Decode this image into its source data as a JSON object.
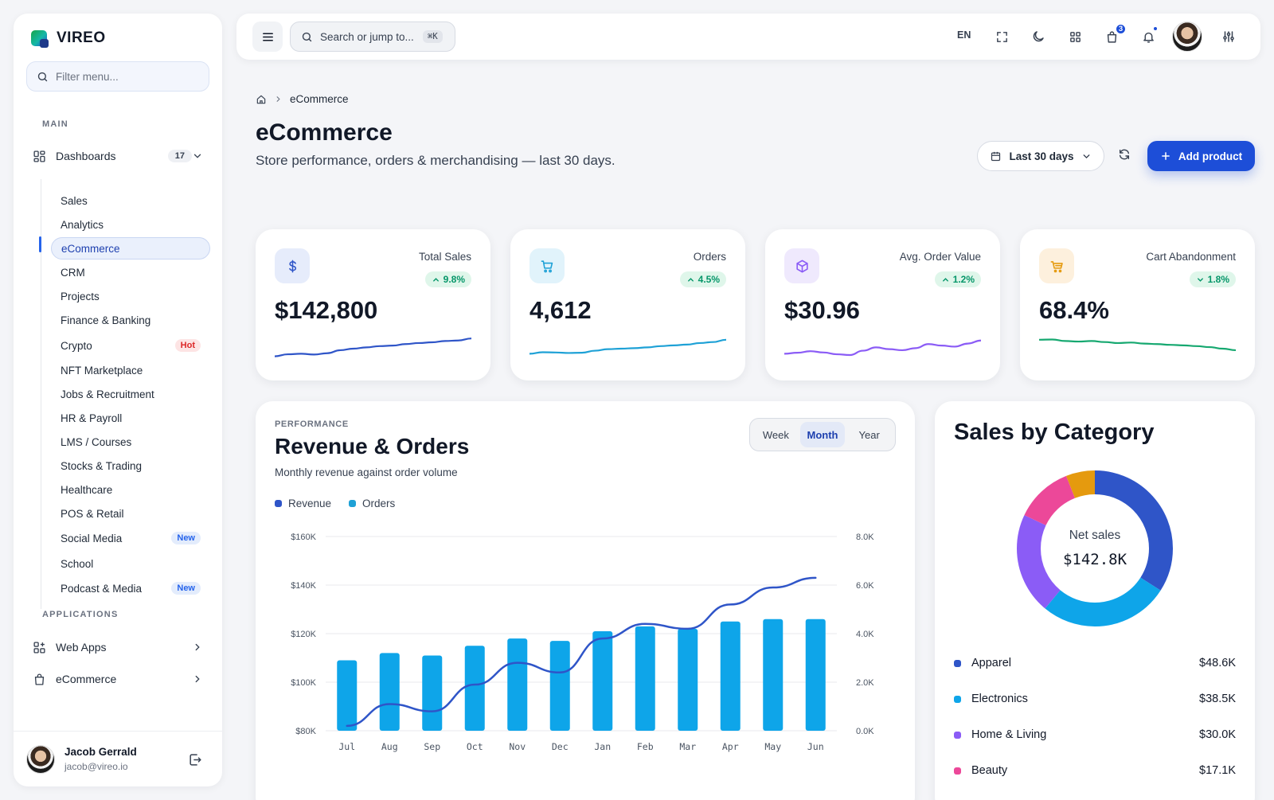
{
  "app": {
    "name": "VIREO"
  },
  "sidebar": {
    "filter_placeholder": "Filter menu...",
    "section_main": "MAIN",
    "dashboards": {
      "label": "Dashboards",
      "count": "17"
    },
    "items": [
      {
        "label": "Sales"
      },
      {
        "label": "Analytics"
      },
      {
        "label": "eCommerce",
        "active": true
      },
      {
        "label": "CRM"
      },
      {
        "label": "Projects"
      },
      {
        "label": "Finance & Banking"
      },
      {
        "label": "Crypto",
        "tag": "Hot"
      },
      {
        "label": "NFT Marketplace"
      },
      {
        "label": "Jobs & Recruitment"
      },
      {
        "label": "HR & Payroll"
      },
      {
        "label": "LMS / Courses"
      },
      {
        "label": "Stocks & Trading"
      },
      {
        "label": "Healthcare"
      },
      {
        "label": "POS & Retail"
      },
      {
        "label": "Social Media",
        "tag": "New"
      },
      {
        "label": "School"
      },
      {
        "label": "Podcast & Media",
        "tag": "New"
      }
    ],
    "section_apps": "APPLICATIONS",
    "apps": [
      {
        "label": "Web Apps"
      },
      {
        "label": "eCommerce"
      }
    ],
    "user": {
      "name": "Jacob Gerrald",
      "email": "jacob@vireo.io"
    }
  },
  "topbar": {
    "search_placeholder": "Search or jump to...",
    "shortcut": "⌘K",
    "language": "EN",
    "cart_count": "3"
  },
  "page": {
    "breadcrumb": "eCommerce",
    "title": "eCommerce",
    "subtitle": "Store performance, orders & merchandising — last 30 days.",
    "date_range": "Last 30 days",
    "add_button": "Add product"
  },
  "kpis": [
    {
      "label": "Total Sales",
      "value": "$142,800",
      "change": "9.8%",
      "direction": "up",
      "color": "#2f55c8",
      "icon": "dollar-icon",
      "icon_bg": "#e6ecfb",
      "icon_color": "#2f55c8",
      "spark": [
        0.2,
        0.28,
        0.3,
        0.27,
        0.32,
        0.44,
        0.5,
        0.55,
        0.6,
        0.62,
        0.68,
        0.72,
        0.75,
        0.8,
        0.82,
        0.9
      ]
    },
    {
      "label": "Orders",
      "value": "4,612",
      "change": "4.5%",
      "direction": "up",
      "color": "#1ea1d6",
      "icon": "cart-icon",
      "icon_bg": "#e1f3fb",
      "icon_color": "#1ea1d6",
      "spark": [
        0.3,
        0.36,
        0.35,
        0.33,
        0.34,
        0.42,
        0.48,
        0.5,
        0.52,
        0.55,
        0.6,
        0.63,
        0.66,
        0.72,
        0.76,
        0.85
      ]
    },
    {
      "label": "Avg. Order Value",
      "value": "$30.96",
      "change": "1.2%",
      "direction": "up",
      "color": "#8b5cf6",
      "icon": "box-icon",
      "icon_bg": "#efe9fd",
      "icon_color": "#8b5cf6",
      "spark": [
        0.3,
        0.34,
        0.4,
        0.35,
        0.28,
        0.25,
        0.42,
        0.55,
        0.48,
        0.44,
        0.52,
        0.68,
        0.62,
        0.58,
        0.7,
        0.82
      ]
    },
    {
      "label": "Cart Abandonment",
      "value": "68.4%",
      "change": "1.8%",
      "direction": "down",
      "color": "#16a870",
      "icon": "basket-icon",
      "icon_bg": "#fdf0dd",
      "icon_color": "#e59a0e",
      "spark": [
        0.85,
        0.86,
        0.8,
        0.78,
        0.8,
        0.76,
        0.72,
        0.74,
        0.7,
        0.68,
        0.65,
        0.63,
        0.6,
        0.56,
        0.5,
        0.44
      ]
    }
  ],
  "performance": {
    "eyebrow": "PERFORMANCE",
    "title": "Revenue & Orders",
    "subtitle": "Monthly revenue against order volume",
    "tabs": [
      "Week",
      "Month",
      "Year"
    ],
    "active_tab": "Month",
    "legend": [
      {
        "name": "Revenue",
        "color": "#2f55c8"
      },
      {
        "name": "Orders",
        "color": "#1ea1d6"
      }
    ]
  },
  "chart_data": {
    "type": "bar",
    "categories": [
      "Jul",
      "Aug",
      "Sep",
      "Oct",
      "Nov",
      "Dec",
      "Jan",
      "Feb",
      "Mar",
      "Apr",
      "May",
      "Jun"
    ],
    "series": [
      {
        "name": "Orders",
        "type": "bar",
        "axis": "left",
        "values": [
          109,
          112,
          111,
          115,
          118,
          117,
          121,
          123,
          122,
          125,
          126,
          126
        ],
        "color": "#0ea5e9"
      },
      {
        "name": "Revenue",
        "type": "line",
        "axis": "right",
        "values": [
          0.2,
          1.1,
          0.8,
          1.9,
          2.8,
          2.4,
          3.8,
          4.4,
          4.2,
          5.2,
          5.9,
          6.3
        ],
        "color": "#2f55c8"
      }
    ],
    "left_axis": {
      "ticks": [
        "$80K",
        "$100K",
        "$120K",
        "$140K",
        "$160K"
      ],
      "ylim": [
        80,
        160
      ]
    },
    "right_axis": {
      "ticks": [
        "0.0K",
        "2.0K",
        "4.0K",
        "6.0K",
        "8.0K"
      ],
      "ylim": [
        0,
        8
      ]
    },
    "grid": true
  },
  "category": {
    "title": "Sales by Category",
    "center_label": "Net sales",
    "center_value": "$142.8K",
    "items": [
      {
        "name": "Apparel",
        "value": "$48.6K",
        "amount": 48.6,
        "color": "#2f55c8"
      },
      {
        "name": "Electronics",
        "value": "$38.5K",
        "amount": 38.5,
        "color": "#0ea5e9"
      },
      {
        "name": "Home & Living",
        "value": "$30.0K",
        "amount": 30.0,
        "color": "#8b5cf6"
      },
      {
        "name": "Beauty",
        "value": "$17.1K",
        "amount": 17.1,
        "color": "#ec4899"
      }
    ],
    "donut_extra": [
      {
        "amount": 8.6,
        "color": "#e59a0e"
      }
    ]
  }
}
